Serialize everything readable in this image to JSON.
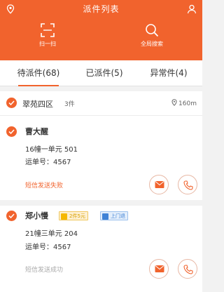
{
  "header": {
    "title": "派件列表",
    "scan_label": "扫一扫",
    "search_label": "全局搜索",
    "color": "#f1632d"
  },
  "tabs": [
    {
      "label": "待派件(68)",
      "active": true
    },
    {
      "label": "已派件(5)",
      "active": false
    },
    {
      "label": "异常件(4)",
      "active": false
    }
  ],
  "group": {
    "name": "翠苑四区",
    "count": "3件",
    "distance": "160m"
  },
  "parcels": [
    {
      "name": "曹大醒",
      "address": "16幢一单元 501",
      "waybill": "运单号：4567",
      "sms_status": "短信发送失败",
      "sms_color": "#f1632d"
    },
    {
      "name": "郑小慢",
      "tag1": "2件5元",
      "tag2": "上门退",
      "address": "21幢三单元 204",
      "waybill": "运单号：4567",
      "sms_status": "短信发送成功",
      "sms_color": "#aaaaaa"
    }
  ],
  "icons": {
    "location": "location-pin-icon",
    "user": "user-icon",
    "scan": "scan-icon",
    "search": "search-icon",
    "mail": "mail-icon",
    "phone": "phone-icon"
  }
}
